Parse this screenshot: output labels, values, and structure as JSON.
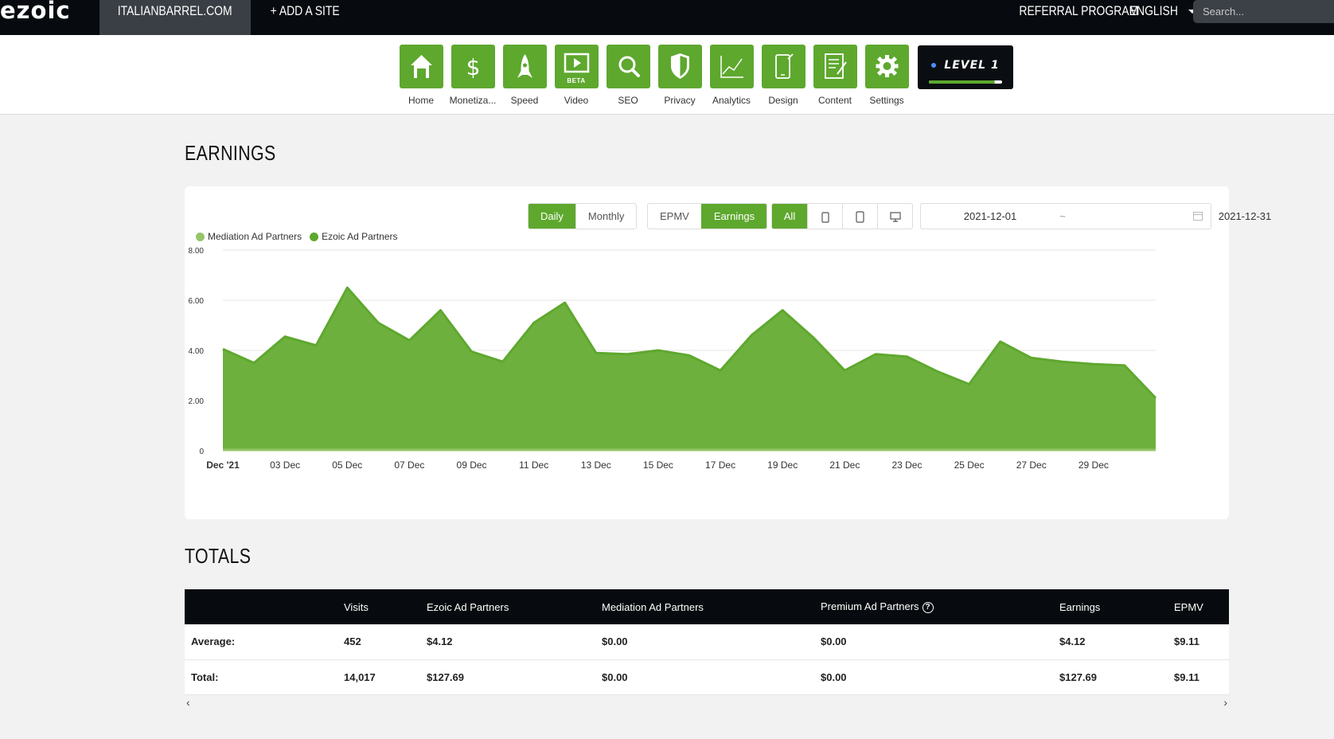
{
  "topbar": {
    "logo": "ezoic",
    "site_name": "ITALIANBARREL.COM",
    "add_site": "+ ADD A SITE",
    "referral": "REFERRAL PROGRAM",
    "language": "ENGLISH",
    "search_placeholder": "Search..."
  },
  "nav": {
    "items": [
      {
        "label": "Home",
        "icon": "home-icon"
      },
      {
        "label": "Monetiza...",
        "icon": "dollar-icon"
      },
      {
        "label": "Speed",
        "icon": "rocket-icon"
      },
      {
        "label": "Video",
        "icon": "video-icon",
        "badge": "BETA"
      },
      {
        "label": "SEO",
        "icon": "magnifier-icon"
      },
      {
        "label": "Privacy",
        "icon": "shield-icon"
      },
      {
        "label": "Analytics",
        "icon": "line-chart-icon"
      },
      {
        "label": "Design",
        "icon": "mobile-design-icon"
      },
      {
        "label": "Content",
        "icon": "document-edit-icon"
      },
      {
        "label": "Settings",
        "icon": "gear-icon"
      }
    ],
    "level": {
      "label": "LEVEL 1",
      "progress": 0.9
    }
  },
  "earnings": {
    "title": "EARNINGS",
    "period_buttons": [
      "Daily",
      "Monthly"
    ],
    "metric_buttons": [
      "EPMV",
      "Earnings"
    ],
    "device_all": "All",
    "date_start": "2021-12-01",
    "date_sep": "~",
    "date_end": "2021-12-31"
  },
  "colors": {
    "accent": "#5ea82e",
    "mediation": "#96c56a",
    "ezoic": "#5ea82e",
    "area_fill": "#6eb03e",
    "dark": "#070b0f"
  },
  "chart_data": {
    "type": "area",
    "legend": [
      "Mediation Ad Partners",
      "Ezoic Ad Partners"
    ],
    "x_labels": [
      "Dec '21",
      "03 Dec",
      "05 Dec",
      "07 Dec",
      "09 Dec",
      "11 Dec",
      "13 Dec",
      "15 Dec",
      "17 Dec",
      "19 Dec",
      "21 Dec",
      "23 Dec",
      "25 Dec",
      "27 Dec",
      "29 Dec"
    ],
    "y_ticks": [
      "0",
      "2.00",
      "4.00",
      "6.00",
      "8.00"
    ],
    "ylim": [
      0,
      8
    ],
    "grid": true,
    "series": [
      {
        "name": "Mediation Ad Partners",
        "values": [
          0,
          0,
          0,
          0,
          0,
          0,
          0,
          0,
          0,
          0,
          0,
          0,
          0,
          0,
          0,
          0,
          0,
          0,
          0,
          0,
          0,
          0,
          0,
          0,
          0,
          0,
          0,
          0,
          0,
          0,
          0
        ]
      },
      {
        "name": "Ezoic Ad Partners",
        "values": [
          4.05,
          3.5,
          4.55,
          4.2,
          6.5,
          5.1,
          4.4,
          5.6,
          3.95,
          3.55,
          5.1,
          5.9,
          3.9,
          3.85,
          4.0,
          3.8,
          3.2,
          4.6,
          5.6,
          4.5,
          3.2,
          3.85,
          3.75,
          3.15,
          2.65,
          4.35,
          3.7,
          3.55,
          3.45,
          3.4,
          2.1
        ]
      }
    ]
  },
  "totals": {
    "title": "TOTALS",
    "columns": [
      "",
      "Visits",
      "Ezoic Ad Partners",
      "Mediation Ad Partners",
      "Premium Ad Partners",
      "Earnings",
      "EPMV"
    ],
    "rows": [
      [
        "Average:",
        "452",
        "$4.12",
        "$0.00",
        "$0.00",
        "$4.12",
        "$9.11"
      ],
      [
        "Total:",
        "14,017",
        "$127.69",
        "$0.00",
        "$0.00",
        "$127.69",
        "$9.11"
      ]
    ]
  }
}
